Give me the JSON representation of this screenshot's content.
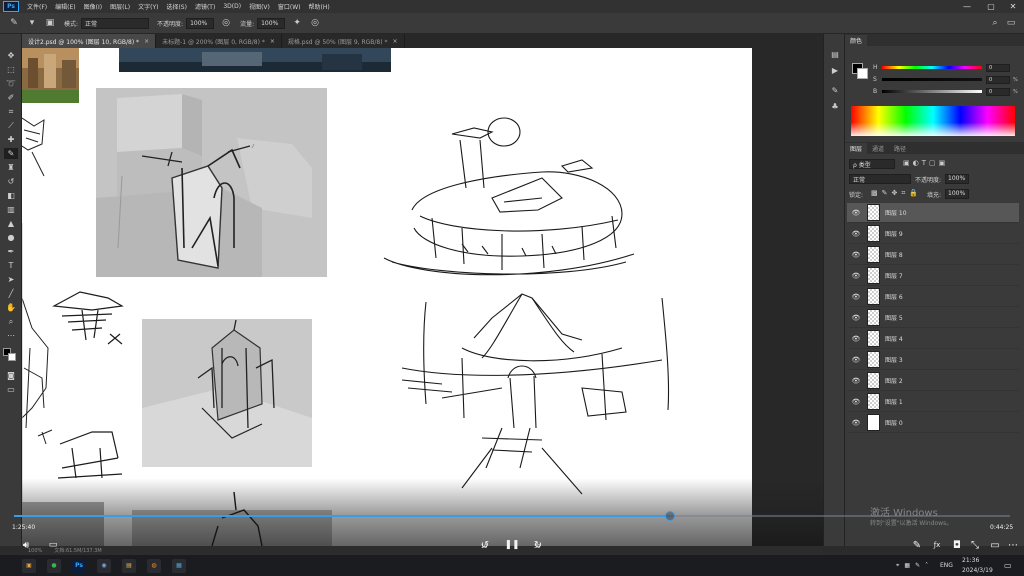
{
  "menubar": {
    "app_logo": "Ps",
    "items": [
      "文件(F)",
      "编辑(E)",
      "图像(I)",
      "图层(L)",
      "文字(Y)",
      "选择(S)",
      "滤镜(T)",
      "3D(D)",
      "视图(V)",
      "窗口(W)",
      "帮助(H)"
    ],
    "window_controls": [
      "—",
      "▢",
      "✕"
    ]
  },
  "options": {
    "mode_label": "模式:",
    "mode_value": "正常",
    "opacity_label": "不透明度:",
    "opacity_value": "100%",
    "flow_label": "流量:",
    "flow_value": "100%"
  },
  "tabs": [
    {
      "label": "设计2.psd @ 100% (图层 10, RGB/8) *",
      "close": "×"
    },
    {
      "label": "未标题-1 @ 200% (图层 0, RGB/8) *",
      "close": "×"
    },
    {
      "label": "规格.psd @ 50% (图层 9, RGB/8) *",
      "close": "×"
    }
  ],
  "color_panel": {
    "tabs": [
      "颜色"
    ],
    "channels": [
      {
        "label": "H",
        "value": "0",
        "unit": ""
      },
      {
        "label": "S",
        "value": "0",
        "unit": "%"
      },
      {
        "label": "B",
        "value": "0",
        "unit": "%"
      }
    ]
  },
  "layers_panel": {
    "tabs": [
      "图层",
      "通道",
      "路径"
    ],
    "filter_kind": "ρ 类型",
    "blend_mode": "正常",
    "opacity_label": "不透明度:",
    "opacity_value": "100%",
    "lock_label": "锁定:",
    "fill_label": "填充:",
    "fill_value": "100%",
    "layers": [
      {
        "name": "图层 10",
        "eye": "👁"
      },
      {
        "name": "图层 9",
        "eye": "👁"
      },
      {
        "name": "图层 8",
        "eye": "👁"
      },
      {
        "name": "图层 7",
        "eye": "👁"
      },
      {
        "name": "图层 6",
        "eye": "👁"
      },
      {
        "name": "图层 5",
        "eye": "👁"
      },
      {
        "name": "图层 4",
        "eye": "👁"
      },
      {
        "name": "图层 3",
        "eye": "👁"
      },
      {
        "name": "图层 2",
        "eye": "👁"
      },
      {
        "name": "图层 1",
        "eye": "👁"
      },
      {
        "name": "图层 0",
        "eye": "👁"
      }
    ]
  },
  "status": {
    "zoom": "100%",
    "doc_info": "文档:61.5M/137.3M"
  },
  "video": {
    "elapsed": "1:25:40",
    "remaining": "0:44:25",
    "progress": 0.659,
    "skip_back_label": "10",
    "skip_forward_label": "30"
  },
  "watermark": {
    "title": "激活 Windows",
    "subtitle": "转到\"设置\"以激活 Windows。"
  },
  "taskbar": {
    "apps": [
      {
        "name": "photo",
        "glyph": "▣",
        "color": "#e8a33d"
      },
      {
        "name": "green-app",
        "glyph": "●",
        "color": "#3ab54a"
      },
      {
        "name": "photoshop",
        "glyph": "Ps",
        "color": "#31a8ff"
      },
      {
        "name": "browser",
        "glyph": "◉",
        "color": "#7aa2d6"
      },
      {
        "name": "folder",
        "glyph": "▤",
        "color": "#e6b84a"
      },
      {
        "name": "blender",
        "glyph": "◍",
        "color": "#f08a24"
      },
      {
        "name": "store",
        "glyph": "▦",
        "color": "#4aa3df"
      }
    ],
    "lang": "ENG",
    "time": "21:36",
    "date": "2024/3/19"
  }
}
